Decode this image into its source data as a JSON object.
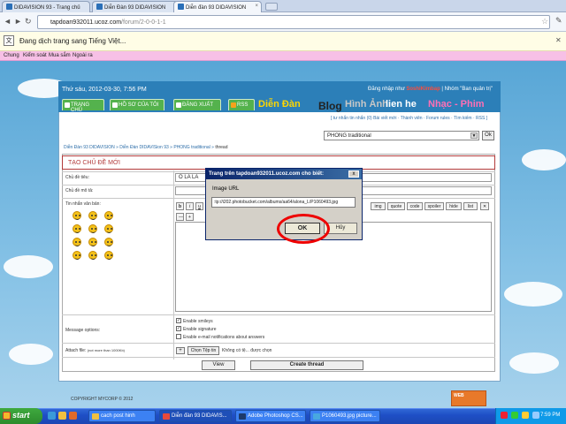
{
  "browser": {
    "tabs": [
      {
        "label": "DIDAVISION 93 - Trang chủ"
      },
      {
        "label": "Diễn Đàn 93 DIDAVISION"
      },
      {
        "label": "Diễn đàn 93 DIDAVISION"
      }
    ],
    "url_domain": "tapdoan932011.ucoz.com",
    "url_path": "/forum/2-0-0-1-1",
    "translate_text": "Đang dịch trang sang Tiếng Việt...",
    "bookmarks": [
      "Chung",
      "Kiểm soát",
      "Mua sắm",
      "Ngoài ra"
    ]
  },
  "site": {
    "datetime": "Thứ sáu, 2012-03-30, 7:56 PM",
    "login_prefix": "Đăng nhập như",
    "login_user": "SoshiKimbap",
    "login_group": "| Nhóm \"Ban quản trị\"",
    "menu": {
      "home": "TRANG CHỦ",
      "profile": "HỒ SƠ CỦA TÔI",
      "logout": "ĐĂNG XUẤT",
      "rss": "RSS",
      "forum": "Diễn Đàn",
      "blog": "Blog",
      "images": "Hình Ảnh",
      "contact": "lien he",
      "music": "Nhạc - Phim"
    },
    "top_links": "[ tư nhắn tin nhắn (0) Bài viết mới · Thành viên · Forum rules · Tìm kiếm · RSS ]",
    "forum_select": "PHONG traditional",
    "ok": "Ok",
    "breadcrumb": {
      "a": "Diễn Đàn 93 DIDAVISION",
      "b": "Diễn Đàn DIDAVISion 93",
      "c": "PHONG traditional",
      "d": "thread"
    },
    "form": {
      "title": "TẠO CHỦ ĐỀ MỚI",
      "subject_label": "Chủ đề tiêu:",
      "subject_value": "O LA LA",
      "desc_label": "Chủ đề mô tả:",
      "message_label": "Tin nhắn văn bản:",
      "toolbar": [
        "b",
        "i",
        "u",
        "img",
        "quote",
        "code",
        "spoiler",
        "hide",
        "list"
      ],
      "options_label": "Message options:",
      "opt_smileys": "Enable smileys",
      "opt_signature": "Enable signature",
      "opt_email": "Enable e-mail notifications about answers",
      "attach_label": "Attach file:",
      "attach_note": "(not more than 1000Kb)",
      "choose_file": "Chọn Tệp tin",
      "no_file": "Không có tệ... được chọn",
      "view": "View",
      "create": "Create thread"
    },
    "copyright": "COPYRIGHT MYCORP © 2012",
    "badge": "WEB"
  },
  "dialog": {
    "title": "Trang trên tapdoan932011.ucoz.com cho biết:",
    "prompt": "Image URL",
    "value": ":tp://i202.photobucket.com/albums/aa64/alona_L/P1060493.jpg",
    "ok": "OK",
    "cancel": "Hủy"
  },
  "taskbar": {
    "start": "start",
    "tasks": [
      "cach post hinh",
      "Diễn đàn 93 DIDAVIS...",
      "Adobe Photoshop CS...",
      "P1060493.jpg picture..."
    ],
    "clock": "7:59 PM"
  }
}
